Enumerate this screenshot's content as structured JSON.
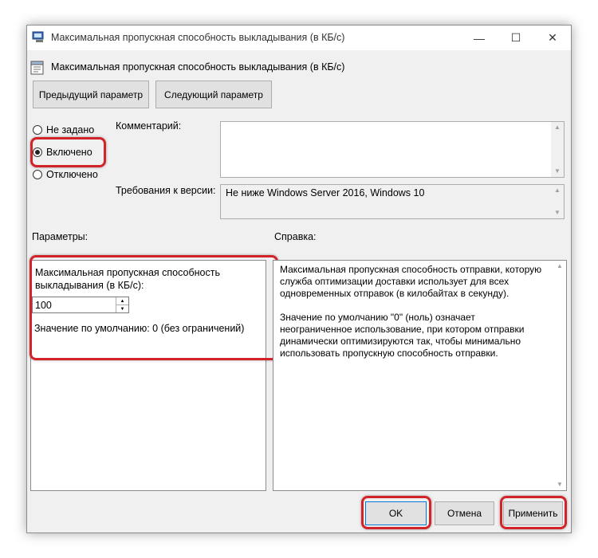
{
  "window": {
    "title": "Максимальная пропускная способность выкладывания (в КБ/с)",
    "minimize_glyph": "—",
    "maximize_glyph": "☐",
    "close_glyph": "✕"
  },
  "heading": {
    "text": "Максимальная пропускная способность выкладывания (в КБ/с)"
  },
  "nav": {
    "prev_label": "Предыдущий параметр",
    "next_label": "Следующий параметр"
  },
  "state": {
    "options": [
      {
        "label": "Не задано",
        "checked": false
      },
      {
        "label": "Включено",
        "checked": true
      },
      {
        "label": "Отключено",
        "checked": false
      }
    ]
  },
  "comment": {
    "label": "Комментарий:",
    "value": ""
  },
  "requirements": {
    "label": "Требования к версии:",
    "value": "Не ниже Windows Server 2016, Windows 10"
  },
  "parameters": {
    "label": "Параметры:",
    "field_label": "Максимальная пропускная способность выкладывания (в КБ/с):",
    "value": "100",
    "default_note": "Значение по умолчанию: 0 (без ограничений)"
  },
  "help": {
    "label": "Справка:",
    "paragraph1": "Максимальная пропускная способность отправки, которую служба оптимизации доставки использует для всех одновременных отправок (в килобайтах в секунду).",
    "paragraph2": "Значение по умолчанию \"0\" (ноль) означает неограниченное использование, при котором отправки динамически оптимизируются так, чтобы минимально использовать пропускную способность отправки."
  },
  "footer": {
    "ok_label": "OK",
    "cancel_label": "Отмена",
    "apply_label": "Применить"
  },
  "colors": {
    "highlight": "#d2232a",
    "window_bg": "#f0f0f0",
    "button_bg": "#e1e1e1"
  }
}
